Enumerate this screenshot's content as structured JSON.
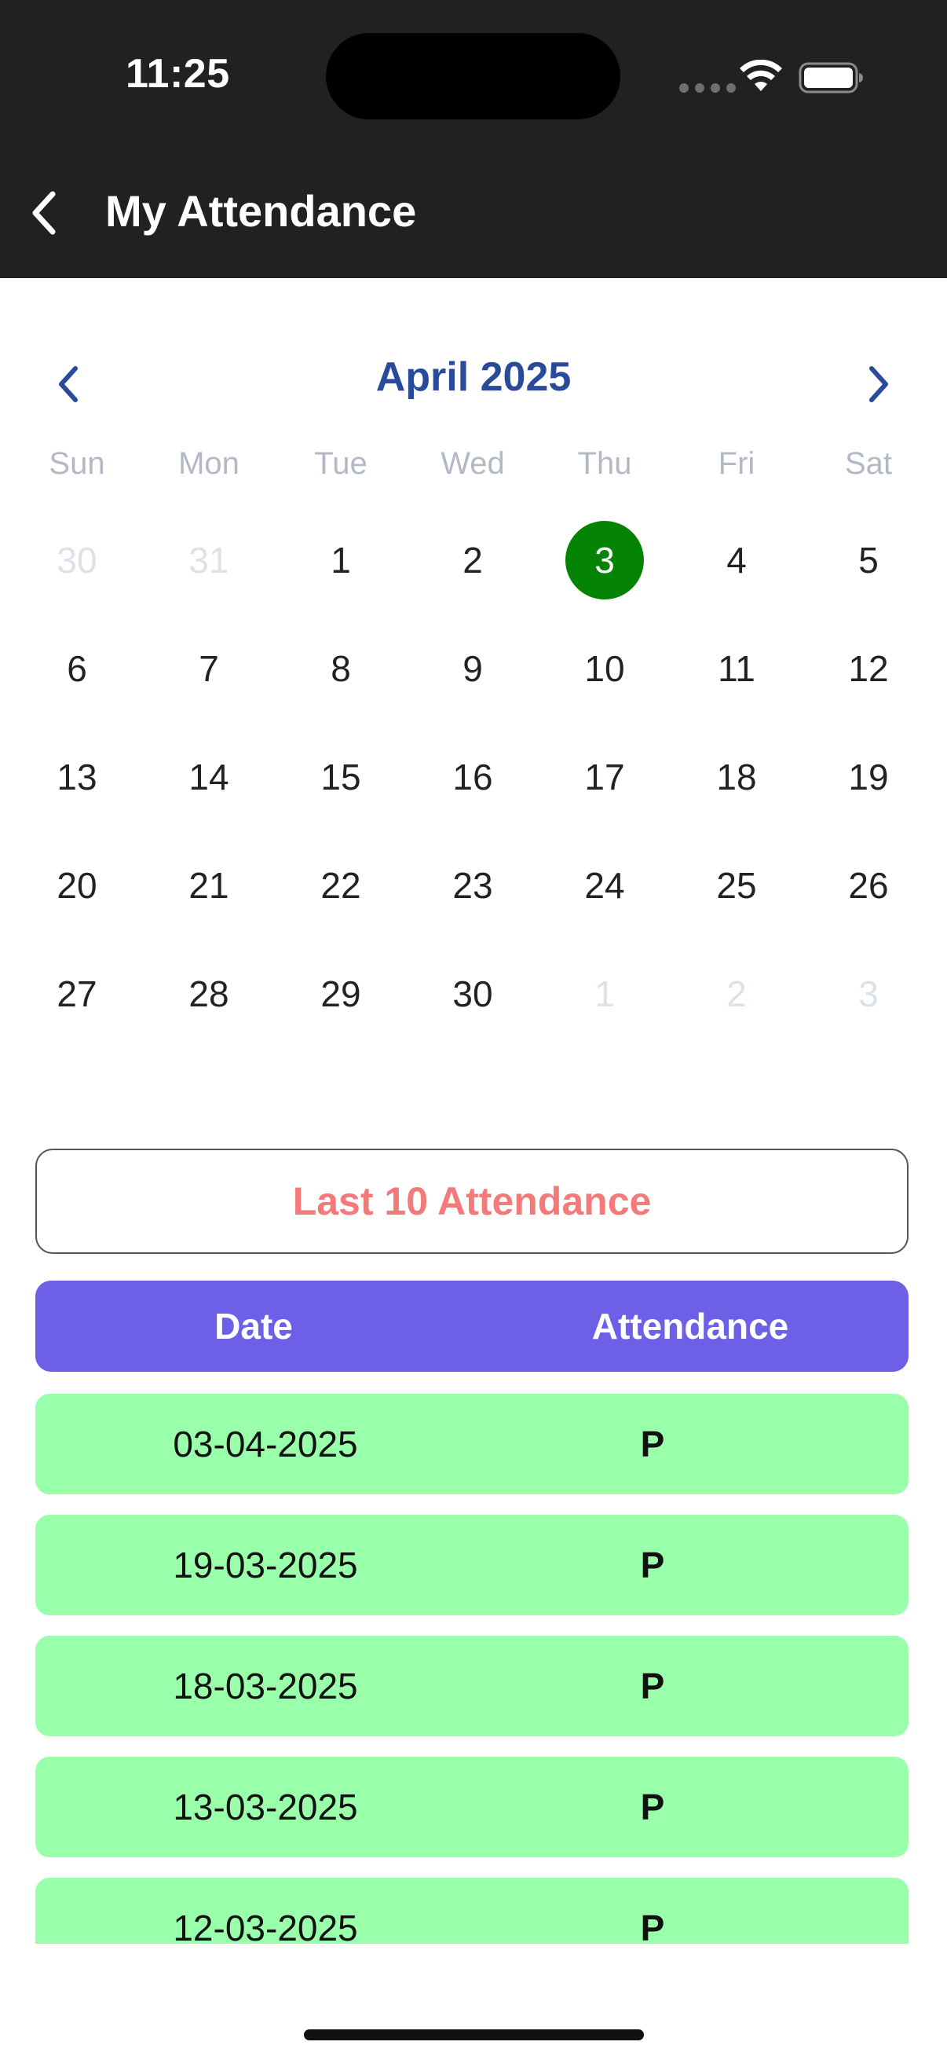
{
  "status_bar": {
    "time": "11:25",
    "icons": [
      "cellular-signal-icon",
      "wifi-icon",
      "battery-icon"
    ]
  },
  "nav": {
    "back_icon": "chevron-left-icon",
    "title": "My Attendance"
  },
  "calendar": {
    "month_label": "April 2025",
    "prev_icon": "chevron-left-icon",
    "next_icon": "chevron-right-icon",
    "accent_color": "#2a4a9a",
    "selected_color": "#058305",
    "weekdays": [
      "Sun",
      "Mon",
      "Tue",
      "Wed",
      "Thu",
      "Fri",
      "Sat"
    ],
    "weeks": [
      [
        {
          "label": "30",
          "muted": true
        },
        {
          "label": "31",
          "muted": true
        },
        {
          "label": "1"
        },
        {
          "label": "2"
        },
        {
          "label": "3",
          "selected": true
        },
        {
          "label": "4"
        },
        {
          "label": "5"
        }
      ],
      [
        {
          "label": "6"
        },
        {
          "label": "7"
        },
        {
          "label": "8"
        },
        {
          "label": "9"
        },
        {
          "label": "10"
        },
        {
          "label": "11"
        },
        {
          "label": "12"
        }
      ],
      [
        {
          "label": "13"
        },
        {
          "label": "14"
        },
        {
          "label": "15"
        },
        {
          "label": "16"
        },
        {
          "label": "17"
        },
        {
          "label": "18"
        },
        {
          "label": "19"
        }
      ],
      [
        {
          "label": "20"
        },
        {
          "label": "21"
        },
        {
          "label": "22"
        },
        {
          "label": "23"
        },
        {
          "label": "24"
        },
        {
          "label": "25"
        },
        {
          "label": "26"
        }
      ],
      [
        {
          "label": "27"
        },
        {
          "label": "28"
        },
        {
          "label": "29"
        },
        {
          "label": "30"
        },
        {
          "label": "1",
          "muted": true
        },
        {
          "label": "2",
          "muted": true
        },
        {
          "label": "3",
          "muted": true
        }
      ]
    ]
  },
  "attendance": {
    "section_button": "Last 10 Attendance",
    "section_button_color": "#f47a7a",
    "header_color": "#6d5fe6",
    "row_color": "#99ffaa",
    "columns": [
      "Date",
      "Attendance"
    ],
    "rows": [
      {
        "date": "03-04-2025",
        "status": "P"
      },
      {
        "date": "19-03-2025",
        "status": "P"
      },
      {
        "date": "18-03-2025",
        "status": "P"
      },
      {
        "date": "13-03-2025",
        "status": "P"
      },
      {
        "date": "12-03-2025",
        "status": "P"
      }
    ]
  }
}
